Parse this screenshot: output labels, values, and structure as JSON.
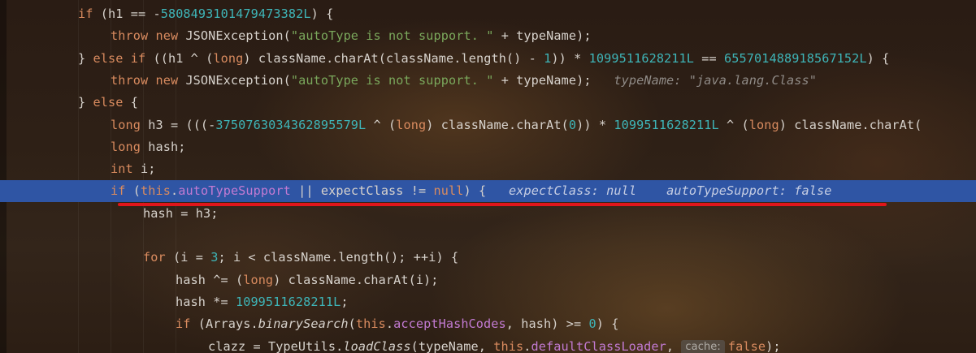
{
  "editor": {
    "lines": [
      {
        "id": "l1",
        "indent": 0,
        "segments": [
          {
            "t": "if",
            "c": "kw"
          },
          {
            "t": " (h1 == -",
            "c": ""
          },
          {
            "t": "5808493101479473382L",
            "c": "num"
          },
          {
            "t": ") {",
            "c": ""
          }
        ]
      },
      {
        "id": "l2",
        "indent": 1,
        "segments": [
          {
            "t": "throw new ",
            "c": "kw"
          },
          {
            "t": "JSONException(",
            "c": ""
          },
          {
            "t": "\"autoType is not support. \"",
            "c": "str"
          },
          {
            "t": " + typeName);",
            "c": ""
          }
        ]
      },
      {
        "id": "l3",
        "indent": 0,
        "segments": [
          {
            "t": "} ",
            "c": ""
          },
          {
            "t": "else if",
            "c": "kw"
          },
          {
            "t": " ((h1 ^ (",
            "c": ""
          },
          {
            "t": "long",
            "c": "kw"
          },
          {
            "t": ") className.charAt(className.length() - ",
            "c": ""
          },
          {
            "t": "1",
            "c": "num"
          },
          {
            "t": ")) * ",
            "c": ""
          },
          {
            "t": "1099511628211L",
            "c": "num"
          },
          {
            "t": " == ",
            "c": ""
          },
          {
            "t": "655701488918567152L",
            "c": "num"
          },
          {
            "t": ") {",
            "c": ""
          }
        ]
      },
      {
        "id": "l4",
        "indent": 1,
        "segments": [
          {
            "t": "throw new ",
            "c": "kw"
          },
          {
            "t": "JSONException(",
            "c": ""
          },
          {
            "t": "\"autoType is not support. \"",
            "c": "str"
          },
          {
            "t": " + typeName);",
            "c": ""
          },
          {
            "t": "   typeName: \"java.lang.Class\"",
            "c": "hint"
          }
        ]
      },
      {
        "id": "l5",
        "indent": 0,
        "segments": [
          {
            "t": "} ",
            "c": ""
          },
          {
            "t": "else",
            "c": "kw"
          },
          {
            "t": " {",
            "c": ""
          }
        ]
      },
      {
        "id": "l6",
        "indent": 1,
        "segments": [
          {
            "t": "long",
            "c": "kw"
          },
          {
            "t": " h3 = (((-",
            "c": ""
          },
          {
            "t": "3750763034362895579L",
            "c": "num"
          },
          {
            "t": " ^ (",
            "c": ""
          },
          {
            "t": "long",
            "c": "kw"
          },
          {
            "t": ") className.charAt(",
            "c": ""
          },
          {
            "t": "0",
            "c": "num"
          },
          {
            "t": ")) * ",
            "c": ""
          },
          {
            "t": "1099511628211L",
            "c": "num"
          },
          {
            "t": " ^ (",
            "c": ""
          },
          {
            "t": "long",
            "c": "kw"
          },
          {
            "t": ") className.charAt(",
            "c": ""
          }
        ]
      },
      {
        "id": "l7",
        "indent": 1,
        "segments": [
          {
            "t": "long",
            "c": "kw"
          },
          {
            "t": " hash;",
            "c": ""
          }
        ]
      },
      {
        "id": "l8",
        "indent": 1,
        "segments": [
          {
            "t": "int",
            "c": "kw"
          },
          {
            "t": " i;",
            "c": ""
          }
        ]
      },
      {
        "id": "l9",
        "indent": 1,
        "current": true,
        "segments": [
          {
            "t": "if",
            "c": "kw"
          },
          {
            "t": " (",
            "c": ""
          },
          {
            "t": "this",
            "c": "kw"
          },
          {
            "t": ".",
            "c": ""
          },
          {
            "t": "autoTypeSupport",
            "c": "field"
          },
          {
            "t": " || expectClass != ",
            "c": ""
          },
          {
            "t": "null",
            "c": "kw"
          },
          {
            "t": ") {",
            "c": ""
          },
          {
            "t": "   expectClass: null    autoTypeSupport: false",
            "c": "hint"
          }
        ]
      },
      {
        "id": "l10",
        "indent": 2,
        "segments": [
          {
            "t": "hash = h3;",
            "c": ""
          }
        ]
      },
      {
        "id": "l11",
        "indent": 2,
        "segments": []
      },
      {
        "id": "l12",
        "indent": 2,
        "segments": [
          {
            "t": "for",
            "c": "kw"
          },
          {
            "t": " (i = ",
            "c": ""
          },
          {
            "t": "3",
            "c": "num"
          },
          {
            "t": "; i < className.length(); ++i) {",
            "c": ""
          }
        ]
      },
      {
        "id": "l13",
        "indent": 3,
        "segments": [
          {
            "t": "hash ^= (",
            "c": ""
          },
          {
            "t": "long",
            "c": "kw"
          },
          {
            "t": ") className.charAt(i);",
            "c": ""
          }
        ]
      },
      {
        "id": "l14",
        "indent": 3,
        "segments": [
          {
            "t": "hash *= ",
            "c": ""
          },
          {
            "t": "1099511628211L",
            "c": "num"
          },
          {
            "t": ";",
            "c": ""
          }
        ]
      },
      {
        "id": "l15",
        "indent": 3,
        "segments": [
          {
            "t": "if",
            "c": "kw"
          },
          {
            "t": " (Arrays.",
            "c": ""
          },
          {
            "t": "binarySearch",
            "c": "italic"
          },
          {
            "t": "(",
            "c": ""
          },
          {
            "t": "this",
            "c": "kw"
          },
          {
            "t": ".",
            "c": ""
          },
          {
            "t": "acceptHashCodes",
            "c": "field"
          },
          {
            "t": ", hash) >= ",
            "c": ""
          },
          {
            "t": "0",
            "c": "num"
          },
          {
            "t": ") {",
            "c": ""
          }
        ]
      },
      {
        "id": "l16",
        "indent": 4,
        "segments": [
          {
            "t": "clazz = TypeUtils.",
            "c": ""
          },
          {
            "t": "loadClass",
            "c": "italic"
          },
          {
            "t": "(typeName, ",
            "c": ""
          },
          {
            "t": "this",
            "c": "kw"
          },
          {
            "t": ".",
            "c": ""
          },
          {
            "t": "defaultClassLoader",
            "c": "field"
          },
          {
            "t": ", ",
            "c": ""
          },
          {
            "t": "cache:",
            "c": "param"
          },
          {
            "t": "false",
            "c": "kw"
          },
          {
            "t": ");",
            "c": ""
          }
        ]
      }
    ]
  },
  "colors": {
    "keyword": "#d98b5f",
    "number": "#3eb5b8",
    "string": "#7aa85c",
    "field": "#c27ad2",
    "current_line": "#2f55a4",
    "underline": "#e0161b"
  }
}
